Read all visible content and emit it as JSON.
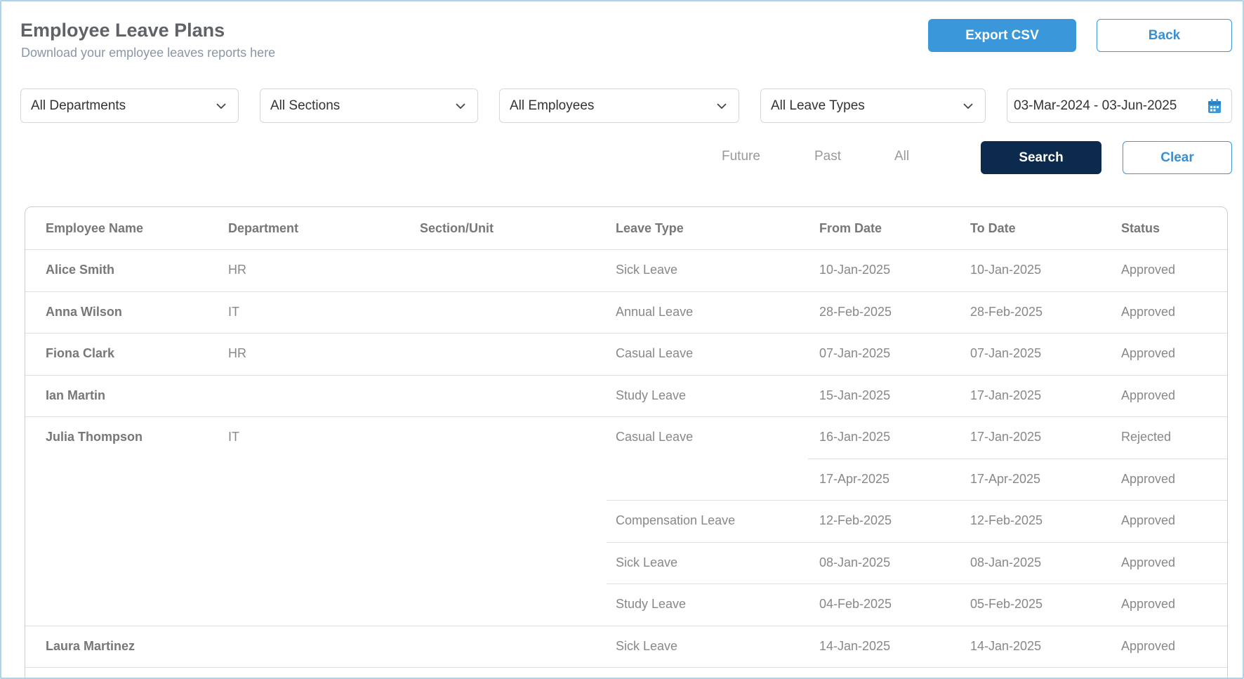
{
  "header": {
    "title": "Employee Leave Plans",
    "subtitle": "Download your employee leaves reports here",
    "export_label": "Export CSV",
    "back_label": "Back"
  },
  "filters": {
    "department": "All Departments",
    "section": "All Sections",
    "employee": "All Employees",
    "leave_type": "All Leave Types",
    "date_range": "03-Mar-2024 - 03-Jun-2025",
    "radio_options": [
      "Future",
      "Past",
      "All"
    ],
    "radio_selected": "All",
    "search_label": "Search",
    "clear_label": "Clear"
  },
  "colors": {
    "accent": "#3a97d9",
    "search_bg": "#0c2a4d",
    "border": "#a9d4ee"
  },
  "table": {
    "columns": [
      "Employee Name",
      "Department",
      "Section/Unit",
      "Leave Type",
      "From Date",
      "To Date",
      "Status"
    ],
    "rows": [
      {
        "name": "Alice Smith",
        "department": "HR",
        "section": "",
        "leave_type": "Sick Leave",
        "from": "10-Jan-2025",
        "to": "10-Jan-2025",
        "status": "Approved"
      },
      {
        "name": "Anna Wilson",
        "department": "IT",
        "section": "",
        "leave_type": "Annual Leave",
        "from": "28-Feb-2025",
        "to": "28-Feb-2025",
        "status": "Approved"
      },
      {
        "name": "Fiona Clark",
        "department": "HR",
        "section": "",
        "leave_type": "Casual Leave",
        "from": "07-Jan-2025",
        "to": "07-Jan-2025",
        "status": "Approved"
      },
      {
        "name": "Ian Martin",
        "department": "",
        "section": "",
        "leave_type": "Study Leave",
        "from": "15-Jan-2025",
        "to": "17-Jan-2025",
        "status": "Approved"
      },
      {
        "name": "Julia Thompson",
        "department": "IT",
        "section": "",
        "leave_type": "Casual Leave",
        "from": "16-Jan-2025",
        "to": "17-Jan-2025",
        "status": "Rejected"
      },
      {
        "name": "",
        "department": "",
        "section": "",
        "leave_type": "",
        "from": "17-Apr-2025",
        "to": "17-Apr-2025",
        "status": "Approved"
      },
      {
        "name": "",
        "department": "",
        "section": "",
        "leave_type": "Compensation Leave",
        "from": "12-Feb-2025",
        "to": "12-Feb-2025",
        "status": "Approved"
      },
      {
        "name": "",
        "department": "",
        "section": "",
        "leave_type": "Sick Leave",
        "from": "08-Jan-2025",
        "to": "08-Jan-2025",
        "status": "Approved"
      },
      {
        "name": "",
        "department": "",
        "section": "",
        "leave_type": "Study Leave",
        "from": "04-Feb-2025",
        "to": "05-Feb-2025",
        "status": "Approved"
      },
      {
        "name": "Laura Martinez",
        "department": "",
        "section": "",
        "leave_type": "Sick Leave",
        "from": "14-Jan-2025",
        "to": "14-Jan-2025",
        "status": "Approved"
      }
    ]
  }
}
